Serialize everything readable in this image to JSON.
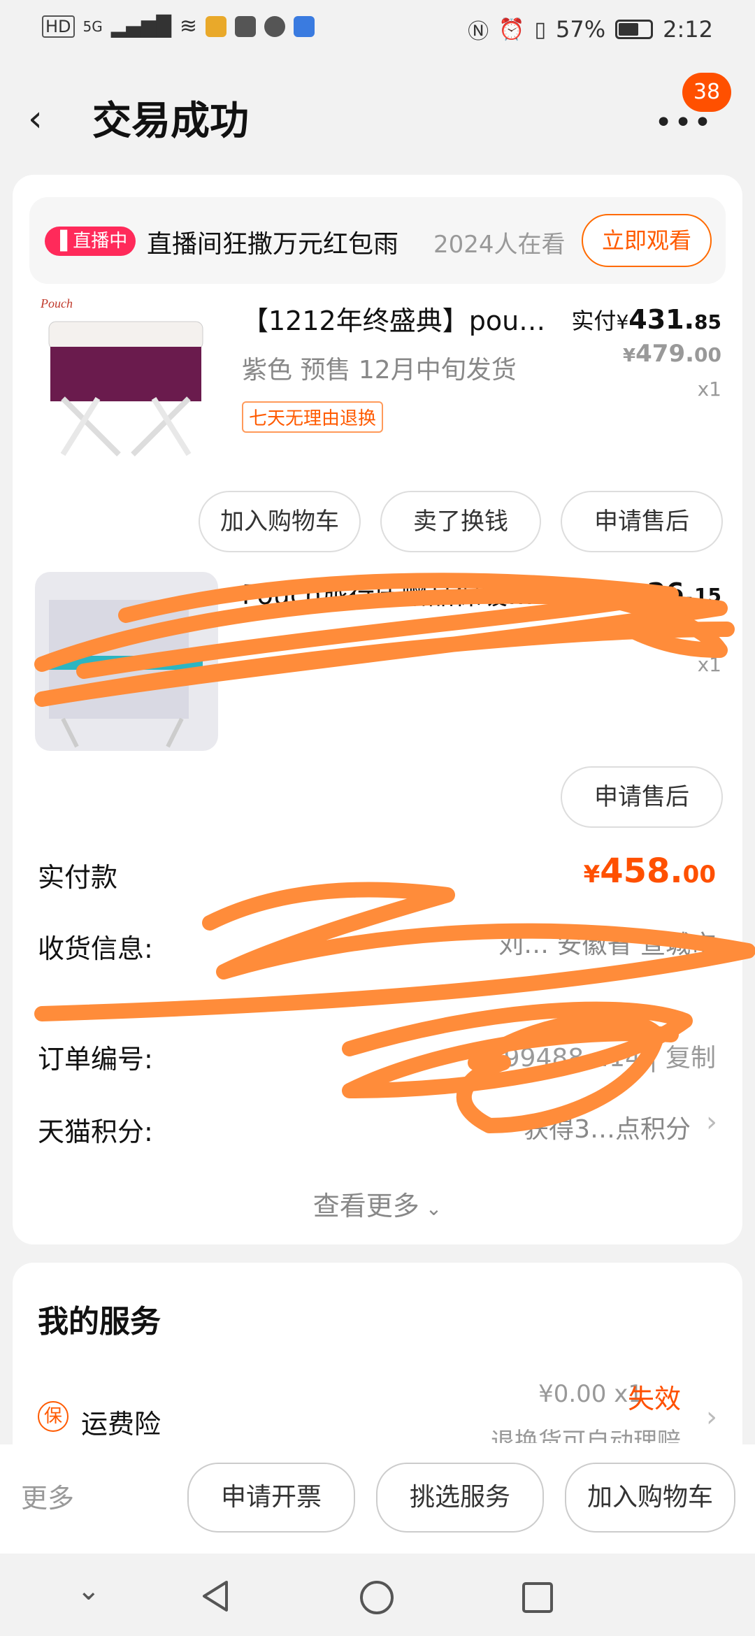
{
  "status_bar": {
    "left_labels": [
      "HD",
      "5G"
    ],
    "battery": "57%",
    "time": "2:12"
  },
  "header": {
    "title": "交易成功",
    "back_icon": "chevron-left-icon",
    "more_icon": "more-dots-icon",
    "message_count": "38"
  },
  "live": {
    "tag": "直播中",
    "text": "直播间狂撒万元红包雨",
    "viewers": "2024人在看",
    "button": "立即观看"
  },
  "product1": {
    "name": "【1212年终盛典】pou…",
    "spec": "紫色  预售 12月中旬发货",
    "tag": "七天无理由退换",
    "paid_label": "实付",
    "paid_symbol": "¥",
    "paid_int": "431.",
    "paid_dec": "85",
    "original_symbol": "¥",
    "original_int": "479.",
    "original_dec": "00",
    "qty": "x1",
    "buttons": [
      "加入购物车",
      "卖了换钱",
      "申请售后"
    ]
  },
  "product2": {
    "name": "Pouch旅行床赠品保暖…",
    "paid_partial": "26.",
    "paid_dec": "15",
    "qty": "x1",
    "button": "申请售后"
  },
  "order": {
    "total_label": "实付款",
    "total_symbol": "¥",
    "total_int": "458.",
    "total_dec": "00",
    "shipping_label": "收货信息:",
    "shipping_value": "刘…  安徽省 宣城市",
    "order_no_label": "订单编号:",
    "order_no_value": "2899488…14 | 复制",
    "points_label": "天猫积分:",
    "points_value": "获得3…点积分",
    "see_more": "查看更多"
  },
  "services": {
    "title": "我的服务",
    "item_icon_text": "保",
    "item_name": "运费险",
    "item_price": "¥0.00 x1",
    "item_status": "失效",
    "item_desc": "退换货可自动理赔"
  },
  "bottom_bar": {
    "more": "更多",
    "buttons": [
      "申请开票",
      "挑选服务",
      "加入购物车"
    ]
  },
  "colors": {
    "accent": "#ff5000",
    "scribble": "#ff8c3a"
  }
}
